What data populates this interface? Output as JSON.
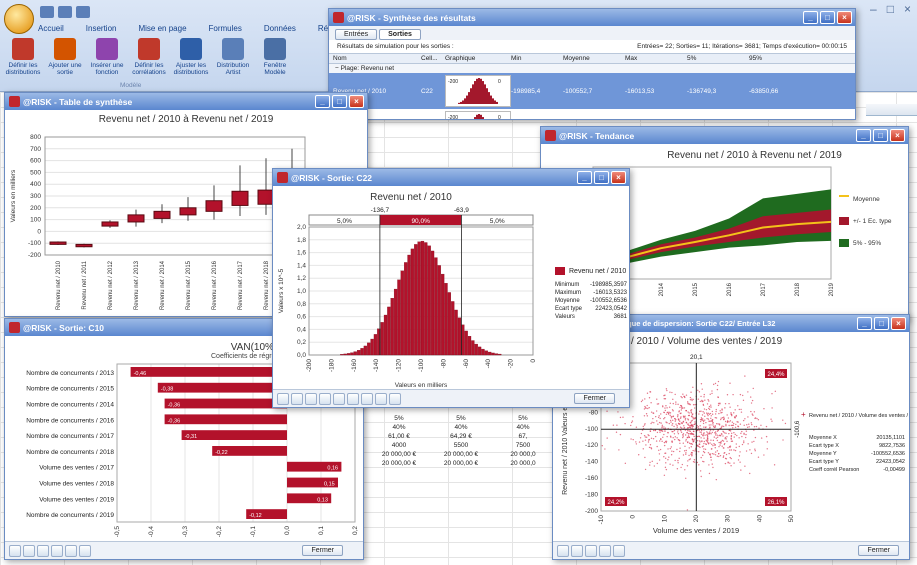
{
  "excel": {
    "tabs": [
      "Accueil",
      "Insertion",
      "Mise en page",
      "Formules",
      "Données",
      "Révision"
    ],
    "ribbon_buttons": [
      "Définir les distributions",
      "Ajouter une sortie",
      "Insérer une fonction",
      "Définir les corrélations",
      "Ajuster les distributions",
      "Distribution Artist",
      "Fenêtre Modèle"
    ],
    "group_label": "Modèle"
  },
  "summary_window": {
    "title": "@RISK - Synthèse des résultats",
    "tabs": [
      "Entrées",
      "Sorties"
    ],
    "subtitle": "Résultats de simulation pour les sorties :",
    "info": "Entrées= 22; Sorties= 11; Itérations= 3681; Temps d'exécution= 00:00:15",
    "headers": [
      "Nom",
      "Cell...",
      "Graphique",
      "Min",
      "Moyenne",
      "Max",
      "5%",
      "95%"
    ],
    "group": "Plage: Revenu net",
    "rows": [
      {
        "name": "Revenu net / 2010",
        "cell": "C22",
        "min": "-198985,4",
        "mean": "-100552,7",
        "max": "-16013,53",
        "p5": "-136749,3",
        "p95": "-63850,66"
      },
      {
        "name": "Revenu net / 2011",
        "cell": "D22",
        "min": "-19680",
        "mean": "",
        "max": "",
        "p5": "",
        "p95": ""
      }
    ],
    "mini_ticks": [
      "-200",
      "0"
    ]
  },
  "table_window": {
    "title": "@RISK - Table de synthèse",
    "chart_title": "Revenu net / 2010 à Revenu net / 2019",
    "ylabel": "Valeurs en milliers",
    "percent_label": "95%"
  },
  "trend_window": {
    "title": "@RISK - Tendance",
    "chart_title": "Revenu net / 2010 à Revenu net / 2019",
    "y_top": "800",
    "legend": [
      "Moyenne",
      "+/- 1 Ec. type",
      "5% - 95%"
    ]
  },
  "output_window": {
    "title": "@RISK - Sortie: C22",
    "chart_title": "Revenu net / 2010",
    "left_cut": "-136,7",
    "right_cut": "-63,9",
    "bands": [
      "5,0%",
      "90,0%",
      "5,0%"
    ],
    "ylabel": "Valeurs x 10^-5",
    "xlabel": "Valeurs en milliers",
    "legend": "Revenu net / 2010",
    "stats": [
      {
        "k": "Minimum",
        "v": "-198985,3597"
      },
      {
        "k": "Maximum",
        "v": "-16013,5323"
      },
      {
        "k": "Moyenne",
        "v": "-100552,6536"
      },
      {
        "k": "Ecart type",
        "v": "22423,0542"
      },
      {
        "k": "Valeurs",
        "v": "3681"
      }
    ],
    "close_label": "Fermer"
  },
  "tornado_window": {
    "title": "@RISK - Sortie: C10",
    "chart_title": "VAN(10%)",
    "chart_subtitle": "Coefficients de régressi",
    "xlabel": "Valeur de coefficient",
    "close_label": "Fermer"
  },
  "scatter_window": {
    "title": "@RISK - Graphique de dispersion: Sortie C22/ Entrée L32",
    "chart_title": "et / 2010 / Volume des ventes / 2019",
    "xlabel": "Volume des ventes / 2019",
    "xlabel2": "Valeurs en milliers",
    "ylabel": "Revenu net / 2010 Valeurs en milliers",
    "top_label": "20,1",
    "right_label": "-100,6",
    "quadrants": [
      "24,4%",
      "24,2%",
      "26,1%"
    ],
    "legend": "Revenu net / 2010 / Volume des ventes / 2019",
    "stats": [
      {
        "k": "Moyenne X",
        "v": "20135,1101"
      },
      {
        "k": "Ecart type X",
        "v": "9822,7536"
      },
      {
        "k": "Moyenne Y",
        "v": "-100552,6536"
      },
      {
        "k": "Ecart type Y",
        "v": "22423,0542"
      },
      {
        "k": "Coeff corrél Pearson",
        "v": "-0,00499"
      }
    ],
    "close_label": "Fermer"
  },
  "grid_values": [
    [
      "5%",
      "5%",
      "5%"
    ],
    [
      "40%",
      "40%",
      "40%"
    ],
    [
      "61,00 €",
      "64,29 €",
      "67,"
    ],
    [
      "4000",
      "5500",
      "7500"
    ],
    [
      "20 000,00 €",
      "20 000,00 €",
      "20 000,0"
    ],
    [
      "20 000,00 €",
      "20 000,00 €",
      "20 000,0"
    ]
  ],
  "chart_data": [
    {
      "type": "box",
      "title": "Revenu net / 2010 à Revenu net / 2019",
      "ylabel": "Valeurs en milliers",
      "categories": [
        "Revenu net / 2010",
        "Revenu net / 2011",
        "Revenu net / 2012",
        "Revenu net / 2013",
        "Revenu net / 2014",
        "Revenu net / 2015",
        "Revenu net / 2016",
        "Revenu net / 2017",
        "Revenu net / 2018",
        "Revenu net / 2019"
      ],
      "q1": [
        -110,
        -130,
        45,
        80,
        110,
        140,
        170,
        220,
        230,
        240
      ],
      "q3": [
        -90,
        -110,
        80,
        140,
        170,
        200,
        260,
        340,
        350,
        360
      ],
      "wlo": [
        -115,
        -135,
        30,
        40,
        70,
        90,
        100,
        130,
        140,
        140
      ],
      "whi": [
        -85,
        -105,
        95,
        185,
        230,
        290,
        390,
        560,
        620,
        700
      ],
      "ylim": [
        -200,
        800
      ],
      "yticks": [
        -200,
        -100,
        0,
        100,
        200,
        300,
        400,
        500,
        600,
        700,
        800
      ]
    },
    {
      "type": "area",
      "title": "Revenu net / 2010 à Revenu net / 2019",
      "x": [
        "2012",
        "2013",
        "2014",
        "2015",
        "2016",
        "2017",
        "2018",
        "2019"
      ],
      "series": [
        {
          "name": "5% - 95%",
          "lo": [
            -120,
            -60,
            0,
            40,
            80,
            100,
            130,
            140
          ],
          "hi": [
            -60,
            50,
            150,
            230,
            340,
            520,
            560,
            600
          ]
        },
        {
          "name": "+/- 1 Ec. type",
          "lo": [
            -100,
            -30,
            40,
            90,
            130,
            170,
            200,
            220
          ],
          "hi": [
            -70,
            20,
            110,
            170,
            250,
            360,
            390,
            420
          ]
        },
        {
          "name": "Moyenne",
          "values": [
            -85,
            -5,
            75,
            130,
            190,
            260,
            290,
            310
          ]
        }
      ],
      "ylim": [
        -200,
        800
      ]
    },
    {
      "type": "histogram",
      "title": "Revenu net / 2010",
      "ylabel": "Valeurs x 10^-5",
      "xlabel": "Valeurs en milliers",
      "xlim": [
        -200,
        0
      ],
      "xticks": [
        -200,
        -180,
        -160,
        -140,
        -120,
        -100,
        -80,
        -60,
        -40,
        -20,
        0
      ],
      "ylim": [
        0,
        2.0
      ],
      "yticks": [
        0.0,
        0.2,
        0.4,
        0.6,
        0.8,
        1.0,
        1.2,
        1.4,
        1.6,
        1.8,
        2.0
      ],
      "ytick_labels": [
        "0,0",
        "0,2",
        "0,4",
        "0,6",
        "0,8",
        "1,0",
        "1,2",
        "1,4",
        "1,6",
        "1,8",
        "2,0"
      ],
      "mean": -100.55,
      "sd": 22.42,
      "cut_low": -136.7,
      "cut_high": -63.9
    },
    {
      "type": "bar",
      "orientation": "horizontal",
      "title": "VAN(10%)",
      "xlabel": "Valeur de coefficient",
      "categories": [
        "Nombre de concurrents / 2013",
        "Nombre de concurrents / 2015",
        "Nombre de concurrents / 2014",
        "Nombre de concurrents / 2016",
        "Nombre de concurrents / 2017",
        "Nombre de concurrents / 2018",
        "Volume des ventes / 2017",
        "Volume des ventes / 2018",
        "Volume des ventes / 2019",
        "Nombre de concurrents / 2019"
      ],
      "values": [
        -0.46,
        -0.38,
        -0.36,
        -0.36,
        -0.31,
        -0.22,
        0.16,
        0.15,
        0.13,
        -0.12
      ],
      "value_labels": [
        "-0,46",
        "-0,38",
        "-0,36",
        "-0,36",
        "-0,31",
        "-0,22",
        "0,16",
        "0,15",
        "0,13",
        "-0,12"
      ],
      "xlim": [
        -0.5,
        0.2
      ],
      "xticks": [
        -0.5,
        -0.4,
        -0.3,
        -0.2,
        -0.1,
        0.0,
        0.1,
        0.2
      ],
      "xtick_labels": [
        "-0,5",
        "-0,4",
        "-0,3",
        "-0,2",
        "-0,1",
        "0,0",
        "0,1",
        "0,2"
      ]
    },
    {
      "type": "scatter",
      "title": "et / 2010 / Volume des ventes / 2019",
      "xlabel": "Volume des ventes / 2019",
      "ylabel": "Revenu net / 2010",
      "xlim": [
        -10,
        50
      ],
      "xticks": [
        -10,
        0,
        10,
        20,
        30,
        40,
        50
      ],
      "ylim": [
        -200,
        -20
      ],
      "yticks": [
        -200,
        -180,
        -160,
        -140,
        -120,
        -100,
        -80,
        -60,
        -40,
        -20
      ],
      "mean_x": 20.1,
      "sd_x": 9.8,
      "mean_y": -100.6,
      "sd_y": 22.4
    }
  ]
}
